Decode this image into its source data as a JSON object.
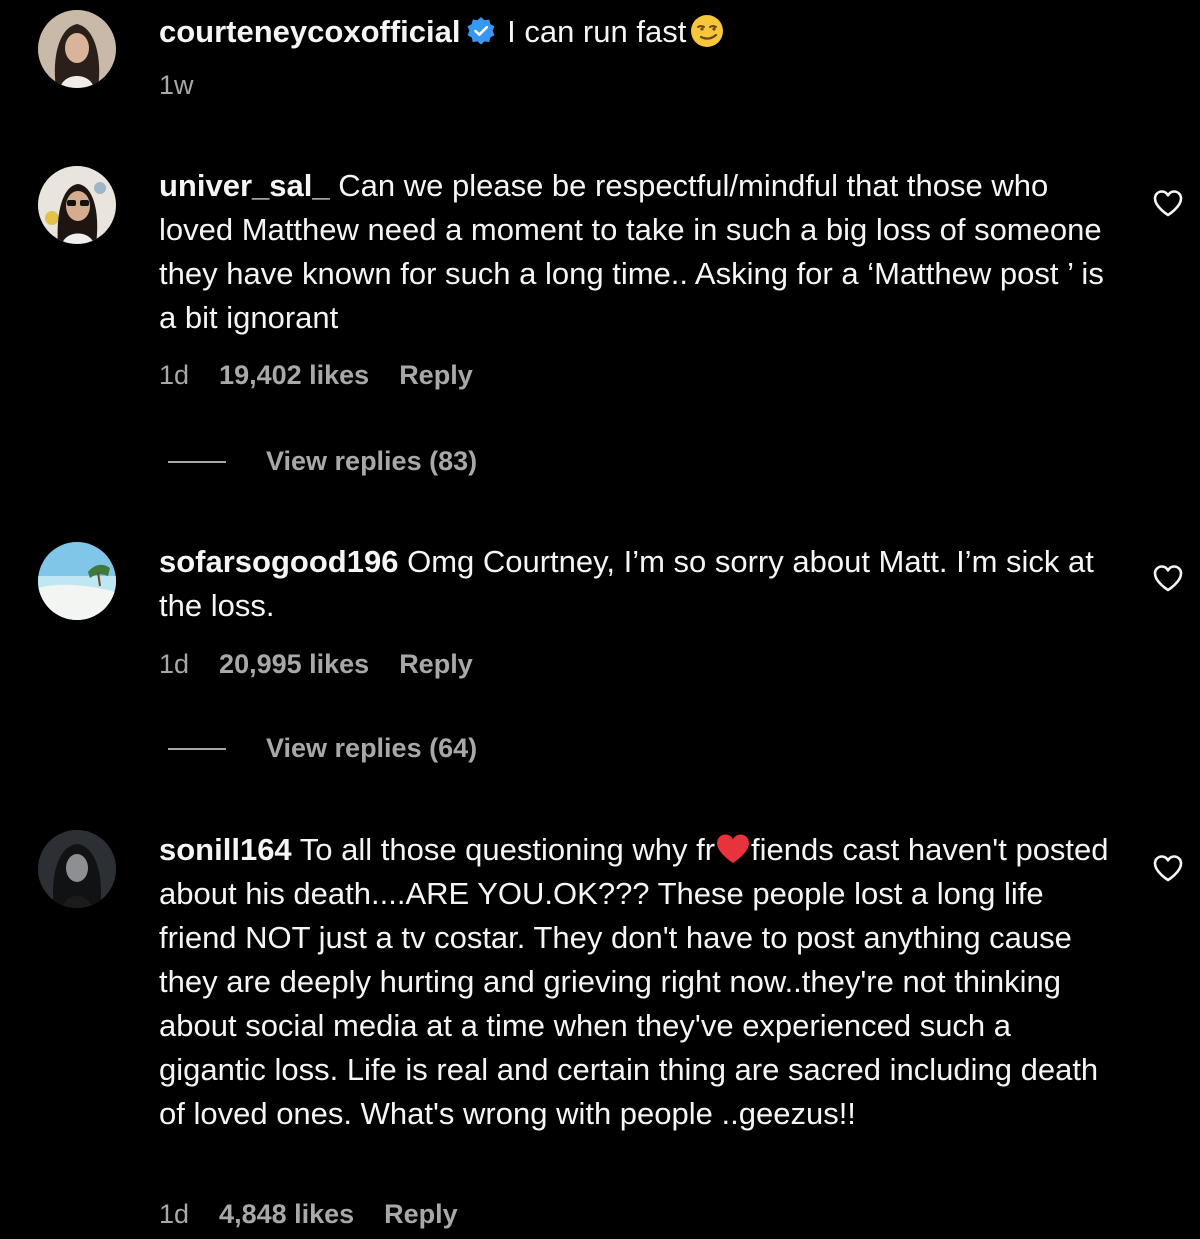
{
  "caption": {
    "username": "courteneycoxofficial",
    "text": "I can run fast",
    "emoji": "smirking-face-emoji",
    "time": "1w"
  },
  "comments": [
    {
      "username": "univer_sal_",
      "text": "Can we please be respectful/mindful that those who loved Matthew need a moment to take in such a big loss of someone they have known for such a long time.. Asking for a ‘Matthew post ’ is a bit ignorant",
      "time": "1d",
      "likes": "19,402 likes",
      "reply_label": "Reply",
      "view_replies": "View replies (83)"
    },
    {
      "username": "sofarsogood196",
      "text": "Omg Courtney, I’m so sorry about Matt. I’m sick at the loss.",
      "time": "1d",
      "likes": "20,995 likes",
      "reply_label": "Reply",
      "view_replies": "View replies (64)"
    },
    {
      "username": "sonill164",
      "text_before": "To all those questioning why fr",
      "text_after": "fiends cast haven't posted about his death....ARE YOU.OK??? These people lost a long life friend NOT just a tv costar. They don't have to post anything cause they are deeply hurting and grieving right now..they're not thinking about social media at a time when they've experienced such a gigantic loss. Life is real and certain thing are sacred including death of loved ones. What's wrong with people ..geezus!!",
      "time": "1d",
      "likes": "4,848 likes",
      "reply_label": "Reply"
    }
  ],
  "colors": {
    "background": "#000000",
    "text": "#f5f5f5",
    "muted": "#a8a8a8",
    "verified": "#3897f0",
    "heart_emoji": "#e8323c"
  },
  "icons": [
    "verified-badge-icon",
    "heart-outline-icon",
    "red-heart-emoji"
  ]
}
